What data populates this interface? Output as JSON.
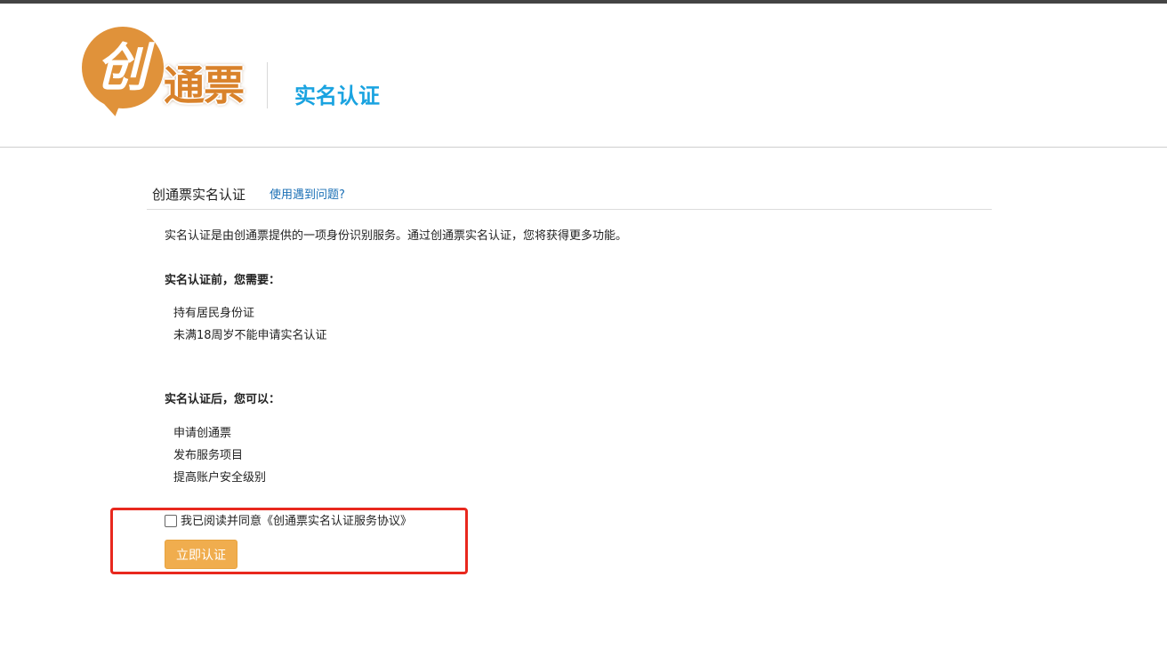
{
  "header": {
    "logo_char_main": "创",
    "logo_chars_rest": "通票",
    "title": "实名认证"
  },
  "card": {
    "title": "创通票实名认证",
    "help_link": "使用遇到问题?"
  },
  "intro": "实名认证是由创通票提供的一项身份识别服务。通过创通票实名认证，您将获得更多功能。",
  "before": {
    "title": "实名认证前，您需要：",
    "items": [
      "持有居民身份证",
      "未满18周岁不能申请实名认证"
    ]
  },
  "after": {
    "title": "实名认证后，您可以：",
    "items": [
      "申请创通票",
      "发布服务项目",
      "提高账户安全级别"
    ]
  },
  "agreement": {
    "checked": false,
    "label": "我已阅读并同意《创通票实名认证服务协议》"
  },
  "verify_button": "立即认证",
  "colors": {
    "brand_orange": "#e0923a",
    "title_blue": "#1aa3e0",
    "button": "#f0ad4e",
    "highlight_red": "#e8281e"
  }
}
